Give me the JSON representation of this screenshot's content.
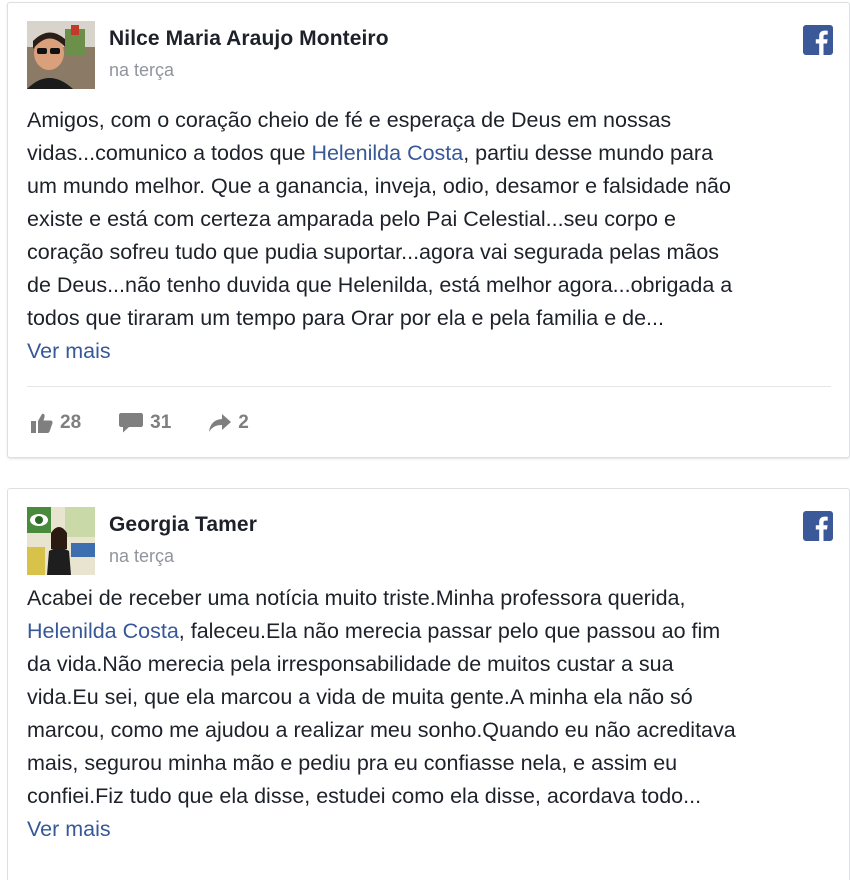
{
  "posts": [
    {
      "author": "Nilce Maria Araujo Monteiro",
      "time": "na terça",
      "text_lines": [
        [
          "Amigos, com o coração cheio de fé e esperaça de Deus em nossas"
        ],
        [
          "vidas...comunico a todos que ",
          "Helenilda Costa",
          ", partiu desse mundo para"
        ],
        [
          "um mundo melhor. Que a ganancia, inveja, odio, desamor e falsidade não"
        ],
        [
          "existe e está com certeza amparada pelo Pai Celestial...seu corpo e"
        ],
        [
          "coração sofreu tudo que pudia suportar...agora vai segurada pelas mãos"
        ],
        [
          "de Deus...não tenho duvida que Helenilda, está melhor agora...obrigada a"
        ],
        [
          "todos que tiraram um tempo para Orar por ela e pela familia e de..."
        ]
      ],
      "see_more": "Ver mais",
      "likes": "28",
      "comments": "31",
      "shares": "2"
    },
    {
      "author": "Georgia Tamer",
      "time": "na terça",
      "text_lines": [
        [
          "Acabei de receber uma notícia muito triste.Minha professora querida,"
        ],
        [
          "",
          "Helenilda Costa",
          ", faleceu.Ela não merecia passar pelo que passou ao fim"
        ],
        [
          "da vida.Não merecia pela irresponsabilidade de muitos custar a sua"
        ],
        [
          "vida.Eu sei, que ela marcou a vida de muita gente.A minha ela não só"
        ],
        [
          "marcou, como me ajudou a realizar meu sonho.Quando eu não acreditava"
        ],
        [
          "mais, segurou minha mão e pediu pra eu confiasse nela, e assim eu"
        ],
        [
          "confiei.Fiz tudo que ela disse, estudei como ela disse, acordava todo..."
        ]
      ],
      "see_more": "Ver mais"
    }
  ],
  "icons": {
    "brand": "facebook-icon",
    "like": "thumbs-up-icon",
    "comment": "comment-bubble-icon",
    "share": "share-arrow-icon"
  },
  "colors": {
    "brand": "#3b5998",
    "link": "#365899",
    "text": "#1d2129",
    "muted": "#90949c",
    "action": "#7f7f7f"
  }
}
